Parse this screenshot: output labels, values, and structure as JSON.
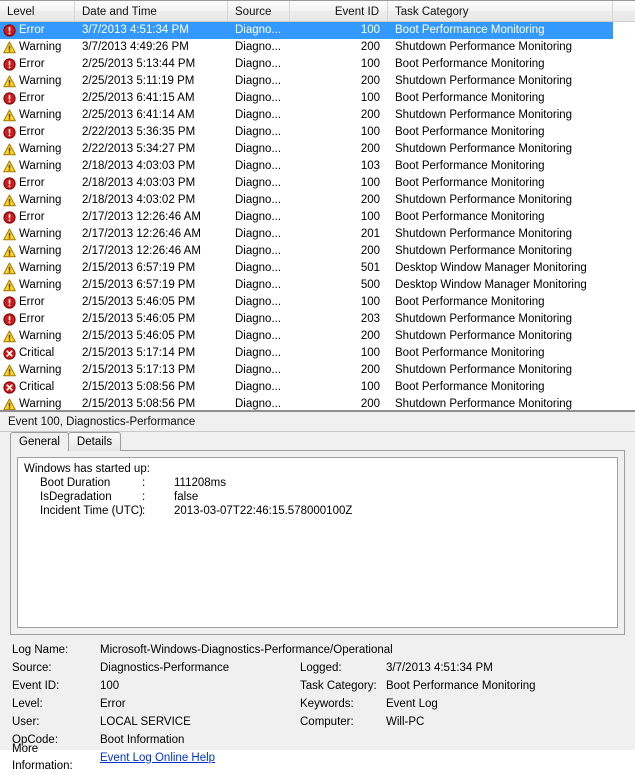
{
  "list": {
    "columns": [
      {
        "key": "level",
        "label": "Level"
      },
      {
        "key": "date",
        "label": "Date and Time"
      },
      {
        "key": "source",
        "label": "Source"
      },
      {
        "key": "eventid",
        "label": "Event ID"
      },
      {
        "key": "task",
        "label": "Task Category"
      }
    ],
    "rows": [
      {
        "icon": "error-icon",
        "level": "Error",
        "date": "3/7/2013 4:51:34 PM",
        "source": "Diagno...",
        "eventid": "100",
        "task": "Boot Performance Monitoring",
        "selected": true
      },
      {
        "icon": "warning-icon",
        "level": "Warning",
        "date": "3/7/2013 4:49:26 PM",
        "source": "Diagno...",
        "eventid": "200",
        "task": "Shutdown Performance Monitoring",
        "selected": false
      },
      {
        "icon": "error-icon",
        "level": "Error",
        "date": "2/25/2013 5:13:44 PM",
        "source": "Diagno...",
        "eventid": "100",
        "task": "Boot Performance Monitoring",
        "selected": false
      },
      {
        "icon": "warning-icon",
        "level": "Warning",
        "date": "2/25/2013 5:11:19 PM",
        "source": "Diagno...",
        "eventid": "200",
        "task": "Shutdown Performance Monitoring",
        "selected": false
      },
      {
        "icon": "error-icon",
        "level": "Error",
        "date": "2/25/2013 6:41:15 AM",
        "source": "Diagno...",
        "eventid": "100",
        "task": "Boot Performance Monitoring",
        "selected": false
      },
      {
        "icon": "warning-icon",
        "level": "Warning",
        "date": "2/25/2013 6:41:14 AM",
        "source": "Diagno...",
        "eventid": "200",
        "task": "Shutdown Performance Monitoring",
        "selected": false
      },
      {
        "icon": "error-icon",
        "level": "Error",
        "date": "2/22/2013 5:36:35 PM",
        "source": "Diagno...",
        "eventid": "100",
        "task": "Boot Performance Monitoring",
        "selected": false
      },
      {
        "icon": "warning-icon",
        "level": "Warning",
        "date": "2/22/2013 5:34:27 PM",
        "source": "Diagno...",
        "eventid": "200",
        "task": "Shutdown Performance Monitoring",
        "selected": false
      },
      {
        "icon": "warning-icon",
        "level": "Warning",
        "date": "2/18/2013 4:03:03 PM",
        "source": "Diagno...",
        "eventid": "103",
        "task": "Boot Performance Monitoring",
        "selected": false
      },
      {
        "icon": "error-icon",
        "level": "Error",
        "date": "2/18/2013 4:03:03 PM",
        "source": "Diagno...",
        "eventid": "100",
        "task": "Boot Performance Monitoring",
        "selected": false
      },
      {
        "icon": "warning-icon",
        "level": "Warning",
        "date": "2/18/2013 4:03:02 PM",
        "source": "Diagno...",
        "eventid": "200",
        "task": "Shutdown Performance Monitoring",
        "selected": false
      },
      {
        "icon": "error-icon",
        "level": "Error",
        "date": "2/17/2013 12:26:46 AM",
        "source": "Diagno...",
        "eventid": "100",
        "task": "Boot Performance Monitoring",
        "selected": false
      },
      {
        "icon": "warning-icon",
        "level": "Warning",
        "date": "2/17/2013 12:26:46 AM",
        "source": "Diagno...",
        "eventid": "201",
        "task": "Shutdown Performance Monitoring",
        "selected": false
      },
      {
        "icon": "warning-icon",
        "level": "Warning",
        "date": "2/17/2013 12:26:46 AM",
        "source": "Diagno...",
        "eventid": "200",
        "task": "Shutdown Performance Monitoring",
        "selected": false
      },
      {
        "icon": "warning-icon",
        "level": "Warning",
        "date": "2/15/2013 6:57:19 PM",
        "source": "Diagno...",
        "eventid": "501",
        "task": "Desktop Window Manager Monitoring",
        "selected": false
      },
      {
        "icon": "warning-icon",
        "level": "Warning",
        "date": "2/15/2013 6:57:19 PM",
        "source": "Diagno...",
        "eventid": "500",
        "task": "Desktop Window Manager Monitoring",
        "selected": false
      },
      {
        "icon": "error-icon",
        "level": "Error",
        "date": "2/15/2013 5:46:05 PM",
        "source": "Diagno...",
        "eventid": "100",
        "task": "Boot Performance Monitoring",
        "selected": false
      },
      {
        "icon": "error-icon",
        "level": "Error",
        "date": "2/15/2013 5:46:05 PM",
        "source": "Diagno...",
        "eventid": "203",
        "task": "Shutdown Performance Monitoring",
        "selected": false
      },
      {
        "icon": "warning-icon",
        "level": "Warning",
        "date": "2/15/2013 5:46:05 PM",
        "source": "Diagno...",
        "eventid": "200",
        "task": "Shutdown Performance Monitoring",
        "selected": false
      },
      {
        "icon": "critical-icon",
        "level": "Critical",
        "date": "2/15/2013 5:17:14 PM",
        "source": "Diagno...",
        "eventid": "100",
        "task": "Boot Performance Monitoring",
        "selected": false
      },
      {
        "icon": "warning-icon",
        "level": "Warning",
        "date": "2/15/2013 5:17:13 PM",
        "source": "Diagno...",
        "eventid": "200",
        "task": "Shutdown Performance Monitoring",
        "selected": false
      },
      {
        "icon": "critical-icon",
        "level": "Critical",
        "date": "2/15/2013 5:08:56 PM",
        "source": "Diagno...",
        "eventid": "100",
        "task": "Boot Performance Monitoring",
        "selected": false
      },
      {
        "icon": "warning-icon",
        "level": "Warning",
        "date": "2/15/2013 5:08:56 PM",
        "source": "Diagno...",
        "eventid": "200",
        "task": "Shutdown Performance Monitoring",
        "selected": false
      }
    ]
  },
  "detail": {
    "title": "Event 100, Diagnostics-Performance",
    "tabs": [
      {
        "label": "General",
        "active": true
      },
      {
        "label": "Details",
        "active": false
      }
    ],
    "description": {
      "heading": "Windows has started up:",
      "entries": [
        {
          "key": "Boot Duration",
          "colon": ":",
          "value": "111208ms"
        },
        {
          "key": "IsDegradation",
          "colon": ":",
          "value": "false"
        },
        {
          "key": "Incident Time (UTC)",
          "colon": ":",
          "value": "2013-03-07T22:46:15.578000100Z"
        }
      ]
    },
    "meta": {
      "log_name_label": "Log Name:",
      "log_name_value": "Microsoft-Windows-Diagnostics-Performance/Operational",
      "rows": [
        {
          "label": "Source:",
          "value": "Diagnostics-Performance",
          "label2": "Logged:",
          "value2": "3/7/2013 4:51:34 PM"
        },
        {
          "label": "Event ID:",
          "value": "100",
          "label2": "Task Category:",
          "value2": "Boot Performance Monitoring"
        },
        {
          "label": "Level:",
          "value": "Error",
          "label2": "Keywords:",
          "value2": "Event Log"
        },
        {
          "label": "User:",
          "value": "LOCAL SERVICE",
          "label2": "Computer:",
          "value2": "Will-PC"
        },
        {
          "label": "OpCode:",
          "value": "Boot Information",
          "label2": "",
          "value2": ""
        }
      ],
      "more_info_label": "More Information:",
      "more_info_link": "Event Log Online Help"
    }
  },
  "colors": {
    "selection": "#3399ff",
    "error": "#c20000",
    "warning": "#ffcc00",
    "critical": "#cc0000",
    "link": "#0033cc"
  }
}
